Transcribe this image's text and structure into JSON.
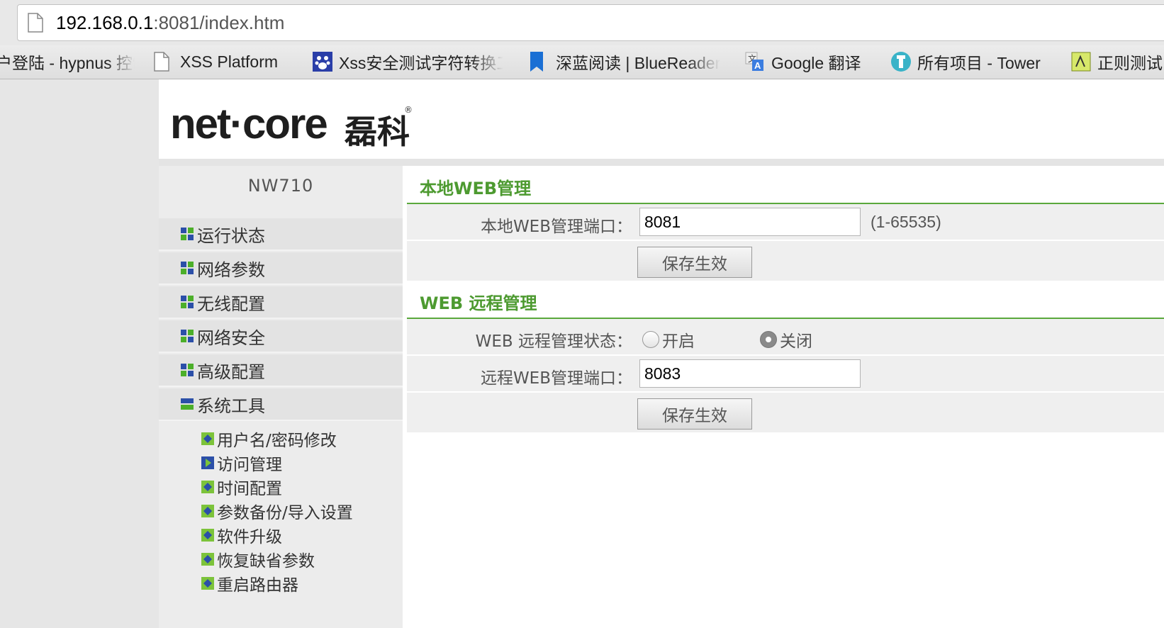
{
  "browser": {
    "url_host": "192.168.0.1",
    "url_path": ":8081/index.htm",
    "bookmarks": [
      {
        "label": "户登陆 - hypnus 控制",
        "icon": "shield-icon"
      },
      {
        "label": "XSS Platform",
        "icon": "page-icon"
      },
      {
        "label": "Xss安全测试字符转换工具",
        "icon": "paw-icon"
      },
      {
        "label": "深蓝阅读 | BlueReader",
        "icon": "bookmark-flag-icon"
      },
      {
        "label": "Google 翻译",
        "icon": "translate-icon"
      },
      {
        "label": "所有项目 - Tower",
        "icon": "tower-icon"
      },
      {
        "label": "正则测试",
        "icon": "regex-icon"
      }
    ]
  },
  "router": {
    "logo_text": "net·core",
    "logo_cn": "磊科",
    "logo_reg": "®",
    "model": "NW710",
    "menu": [
      {
        "label": "运行状态",
        "expanded": false
      },
      {
        "label": "网络参数",
        "expanded": false
      },
      {
        "label": "无线配置",
        "expanded": false
      },
      {
        "label": "网络安全",
        "expanded": false
      },
      {
        "label": "高级配置",
        "expanded": false
      },
      {
        "label": "系统工具",
        "expanded": true
      }
    ],
    "submenu": [
      {
        "label": "用户名/密码修改",
        "active": false
      },
      {
        "label": "访问管理",
        "active": true
      },
      {
        "label": "时间配置",
        "active": false
      },
      {
        "label": "参数备份/导入设置",
        "active": false
      },
      {
        "label": "软件升级",
        "active": false
      },
      {
        "label": "恢复缺省参数",
        "active": false
      },
      {
        "label": "重启路由器",
        "active": false
      }
    ]
  },
  "local_web": {
    "title": "本地WEB管理",
    "port_label": "本地WEB管理端口：",
    "port_value": "8081",
    "port_hint": "(1-65535)",
    "save_label": "保存生效"
  },
  "remote_web": {
    "title": "WEB 远程管理",
    "status_label": "WEB 远程管理状态：",
    "option_on": "开启",
    "option_off": "关闭",
    "selected": "关闭",
    "port_label": "远程WEB管理端口：",
    "port_value": "8083",
    "save_label": "保存生效"
  },
  "colors": {
    "accent_green": "#4d9a30",
    "section_rule": "#5aa83c",
    "menu_icon_blue": "#2b4fa8",
    "menu_icon_green": "#4caf2a"
  }
}
